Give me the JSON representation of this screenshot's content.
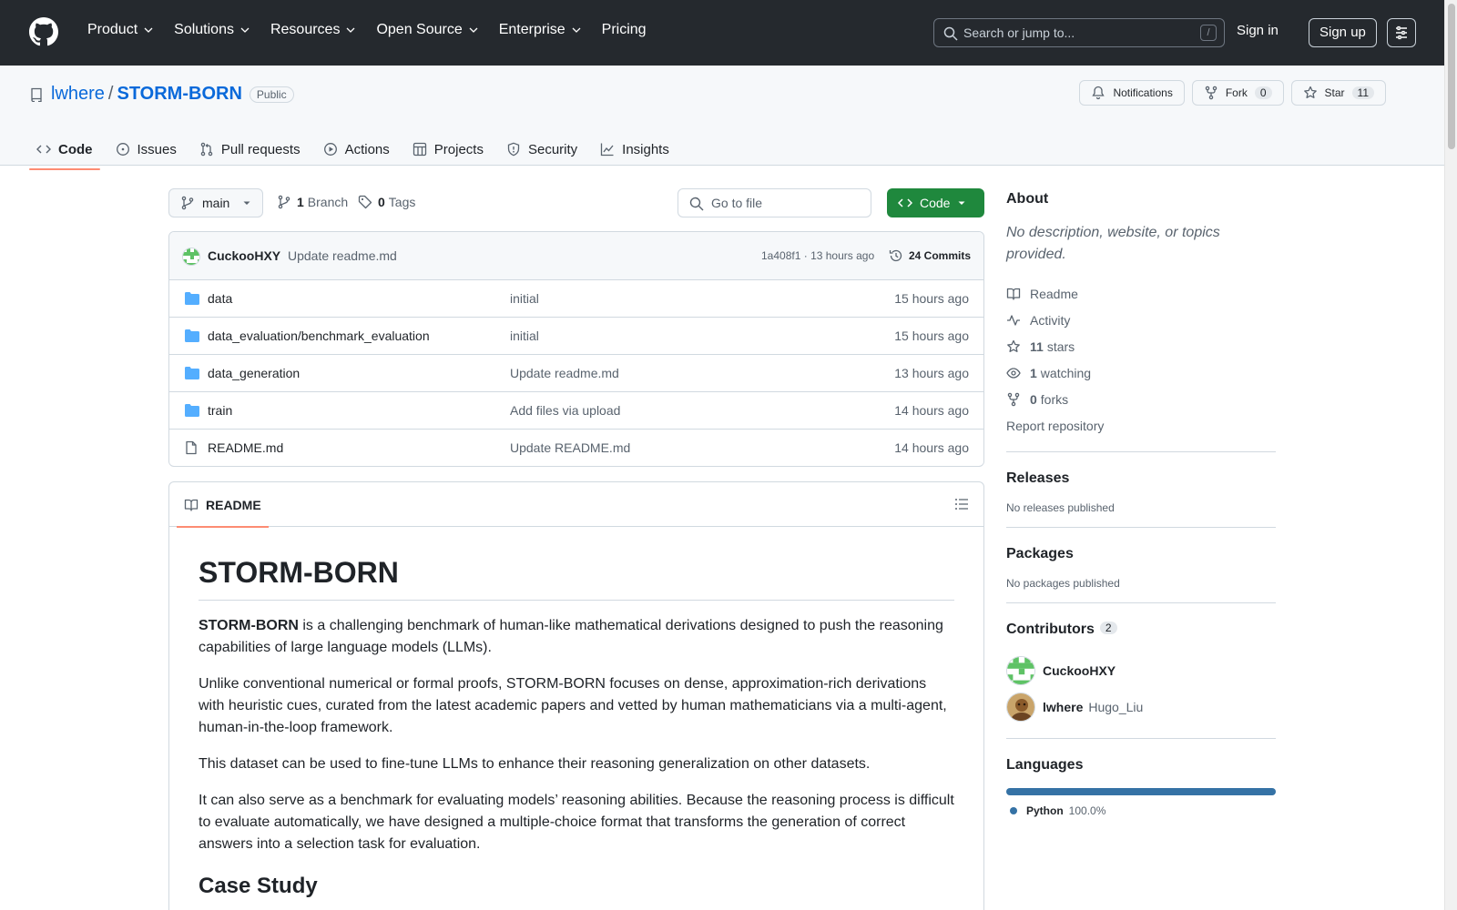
{
  "header": {
    "nav": [
      {
        "label": "Product",
        "dropdown": true
      },
      {
        "label": "Solutions",
        "dropdown": true
      },
      {
        "label": "Resources",
        "dropdown": true
      },
      {
        "label": "Open Source",
        "dropdown": true
      },
      {
        "label": "Enterprise",
        "dropdown": true
      },
      {
        "label": "Pricing",
        "dropdown": false
      }
    ],
    "search_placeholder": "Search or jump to...",
    "search_shortcut": "/",
    "sign_in": "Sign in",
    "sign_up": "Sign up"
  },
  "repo": {
    "owner": "lwhere",
    "separator": "/",
    "name": "STORM-BORN",
    "visibility": "Public",
    "actions": {
      "notifications": "Notifications",
      "fork_label": "Fork",
      "fork_count": "0",
      "star_label": "Star",
      "star_count": "11"
    },
    "tabs": [
      {
        "label": "Code",
        "icon": "code-icon",
        "active": true
      },
      {
        "label": "Issues",
        "icon": "issue-icon",
        "active": false
      },
      {
        "label": "Pull requests",
        "icon": "pull-request-icon",
        "active": false
      },
      {
        "label": "Actions",
        "icon": "play-icon",
        "active": false
      },
      {
        "label": "Projects",
        "icon": "table-icon",
        "active": false
      },
      {
        "label": "Security",
        "icon": "shield-icon",
        "active": false
      },
      {
        "label": "Insights",
        "icon": "graph-icon",
        "active": false
      }
    ]
  },
  "toolbar": {
    "branch": "main",
    "branch_count": "1",
    "branch_label": "Branch",
    "tag_count": "0",
    "tag_label": "Tags",
    "goto_placeholder": "Go to file",
    "code_button": "Code"
  },
  "commit": {
    "author": "CuckooHXY",
    "message": "Update readme.md",
    "sha": "1a408f1",
    "dot": "·",
    "time": "13 hours ago",
    "count_label": "24 Commits"
  },
  "files": [
    {
      "name": "data",
      "type": "folder",
      "message": "initial",
      "time": "15 hours ago"
    },
    {
      "name": "data_evaluation/benchmark_evaluation",
      "type": "folder",
      "message": "initial",
      "time": "15 hours ago"
    },
    {
      "name": "data_generation",
      "type": "folder",
      "message": "Update readme.md",
      "time": "13 hours ago"
    },
    {
      "name": "train",
      "type": "folder",
      "message": "Add files via upload",
      "time": "14 hours ago"
    },
    {
      "name": "README.md",
      "type": "file",
      "message": "Update README.md",
      "time": "14 hours ago"
    }
  ],
  "readme": {
    "tab_label": "README",
    "title": "STORM-BORN",
    "p1_bold": "STORM-BORN",
    "p1_rest": " is a challenging benchmark of human‑like mathematical derivations designed to push the reasoning capabilities of large language models (LLMs).",
    "p2": "Unlike conventional numerical or formal proofs, STORM-BORN focuses on dense, approximation-rich derivations with heuristic cues, curated from the latest academic papers and vetted by human mathematicians via a multi‑agent, human-in-the-loop framework.",
    "p3": "This dataset can be used to fine-tune LLMs to enhance their reasoning generalization on other datasets.",
    "p4": "It can also serve as a benchmark for evaluating models’ reasoning abilities. Because the reasoning process is difficult to evaluate automatically, we have designed a multiple-choice format that transforms the generation of correct answers into a selection task for evaluation.",
    "h2": "Case Study"
  },
  "sidebar": {
    "about_title": "About",
    "about_desc": "No description, website, or topics provided.",
    "links": [
      {
        "icon": "book-icon",
        "count": "",
        "label": "Readme"
      },
      {
        "icon": "pulse-icon",
        "count": "",
        "label": "Activity"
      },
      {
        "icon": "star-icon",
        "count": "11",
        "label": "stars"
      },
      {
        "icon": "eye-icon",
        "count": "1",
        "label": "watching"
      },
      {
        "icon": "fork-icon",
        "count": "0",
        "label": "forks"
      }
    ],
    "report": "Report repository",
    "releases_title": "Releases",
    "releases_sub": "No releases published",
    "packages_title": "Packages",
    "packages_sub": "No packages published",
    "contributors_title": "Contributors",
    "contributors_count": "2",
    "contributors": [
      {
        "login": "CuckooHXY",
        "name": ""
      },
      {
        "login": "lwhere",
        "name": "Hugo_Liu"
      }
    ],
    "languages_title": "Languages",
    "languages": [
      {
        "name": "Python",
        "percent": "100.0%",
        "color": "#3572a5"
      }
    ]
  },
  "colors": {
    "header_bg": "#25292e",
    "link": "#0969da",
    "primary_button": "#1f883d",
    "active_tab_underline": "#fd8c73",
    "folder": "#54aeff"
  }
}
